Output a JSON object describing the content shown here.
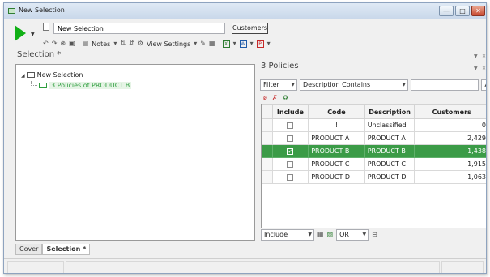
{
  "window": {
    "title": "New Selection",
    "controls": {
      "minimize": "—",
      "maximize": "□",
      "close": "✕"
    }
  },
  "toolbar": {
    "selection_name": "New Selection",
    "customers_label": "Customers",
    "notes_label": "Notes",
    "view_settings_label": "View Settings"
  },
  "left_panel": {
    "title": "Selection *",
    "tree": {
      "root": "New Selection",
      "child": "3 Policies of PRODUCT B"
    }
  },
  "right_panel": {
    "title": "3 Policies",
    "filter_label": "Filter",
    "filter_mode": "Description Contains",
    "filter_value": "",
    "grid": {
      "columns": [
        "Include",
        "Code",
        "Description",
        "Customers"
      ],
      "rows": [
        {
          "include": false,
          "code": "!",
          "description": "Unclassified",
          "customers": "0",
          "selected": false
        },
        {
          "include": false,
          "code": "PRODUCT A",
          "description": "PRODUCT A",
          "customers": "2,429",
          "selected": false
        },
        {
          "include": true,
          "code": "PRODUCT B",
          "description": "PRODUCT B",
          "customers": "1,438",
          "selected": true
        },
        {
          "include": false,
          "code": "PRODUCT C",
          "description": "PRODUCT C",
          "customers": "1,915",
          "selected": false
        },
        {
          "include": false,
          "code": "PRODUCT D",
          "description": "PRODUCT D",
          "customers": "1,063",
          "selected": false
        }
      ]
    },
    "bottom": {
      "mode": "Include",
      "operator": "OR"
    }
  },
  "tabs": [
    {
      "label": "Cover",
      "active": false
    },
    {
      "label": "Selection *",
      "active": true
    }
  ],
  "colors": {
    "selected_row": "#3b9b47",
    "run_button": "#11b016",
    "tree_child": "#2e9e3e"
  }
}
